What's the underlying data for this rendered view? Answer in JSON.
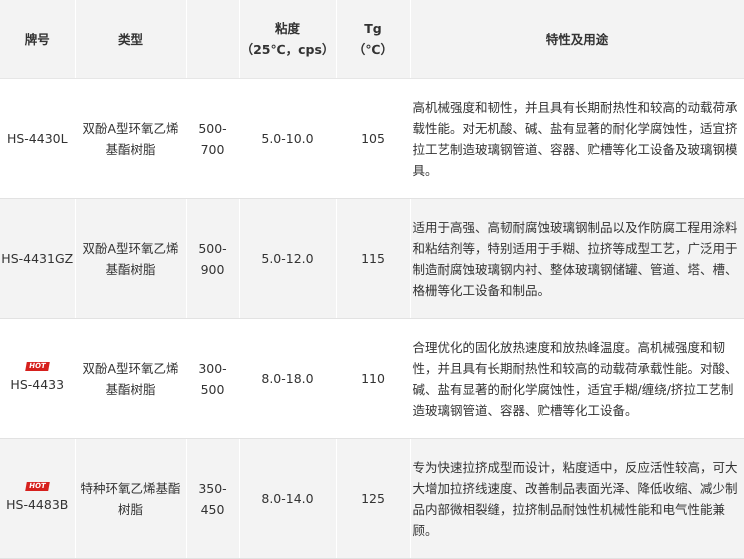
{
  "headers": {
    "brand": "牌号",
    "type": "类型",
    "viscosity_line1": "粘度",
    "viscosity_line2": "（25℃，cps）",
    "tg_line1": "Tg",
    "tg_line2": "（℃）",
    "properties": "特性及用途"
  },
  "rows": [
    {
      "code": "HS-4430L",
      "hot": "",
      "type": "双酚A型环氧乙烯基酯树脂",
      "range": "500-700",
      "viscosity": "5.0-10.0",
      "tg": "105",
      "desc": "高机械强度和韧性，并且具有长期耐热性和较高的动载荷承载性能。对无机酸、碱、盐有显著的耐化学腐蚀性，适宜挤拉工艺制造玻璃钢管道、容器、贮槽等化工设备及玻璃钢模具。"
    },
    {
      "code": "HS-4431GZ",
      "hot": "",
      "type": "双酚A型环氧乙烯基酯树脂",
      "range": "500-900",
      "viscosity": "5.0-12.0",
      "tg": "115",
      "desc": "适用于高强、高韧耐腐蚀玻璃钢制品以及作防腐工程用涂料和粘结剂等，特别适用于手糊、拉挤等成型工艺，广泛用于制造耐腐蚀玻璃钢内衬、整体玻璃钢储罐、管道、塔、槽、格栅等化工设备和制品。"
    },
    {
      "code": "HS-4433",
      "hot": "HOT",
      "type": "双酚A型环氧乙烯基酯树脂",
      "range": "300-500",
      "viscosity": "8.0-18.0",
      "tg": "110",
      "desc": "合理优化的固化放热速度和放热峰温度。高机械强度和韧性，并且具有长期耐热性和较高的动载荷承载性能。对酸、碱、盐有显著的耐化学腐蚀性，适宜手糊/缠绕/挤拉工艺制造玻璃钢管道、容器、贮槽等化工设备。"
    },
    {
      "code": "HS-4483B",
      "hot": "HOT",
      "type": "特种环氧乙烯基酯树脂",
      "range": "350-450",
      "viscosity": "8.0-14.0",
      "tg": "125",
      "desc": "专为快速拉挤成型而设计，粘度适中，反应活性较高，可大大增加拉挤线速度、改善制品表面光泽、降低收缩、减少制品内部微相裂缝，拉挤制品耐蚀性机械性能和电气性能兼顾。"
    }
  ],
  "colors": {
    "header_bg": "#f3f3f3",
    "alt_row_bg": "#f3f3f3",
    "hot_badge": "#d6201d"
  }
}
